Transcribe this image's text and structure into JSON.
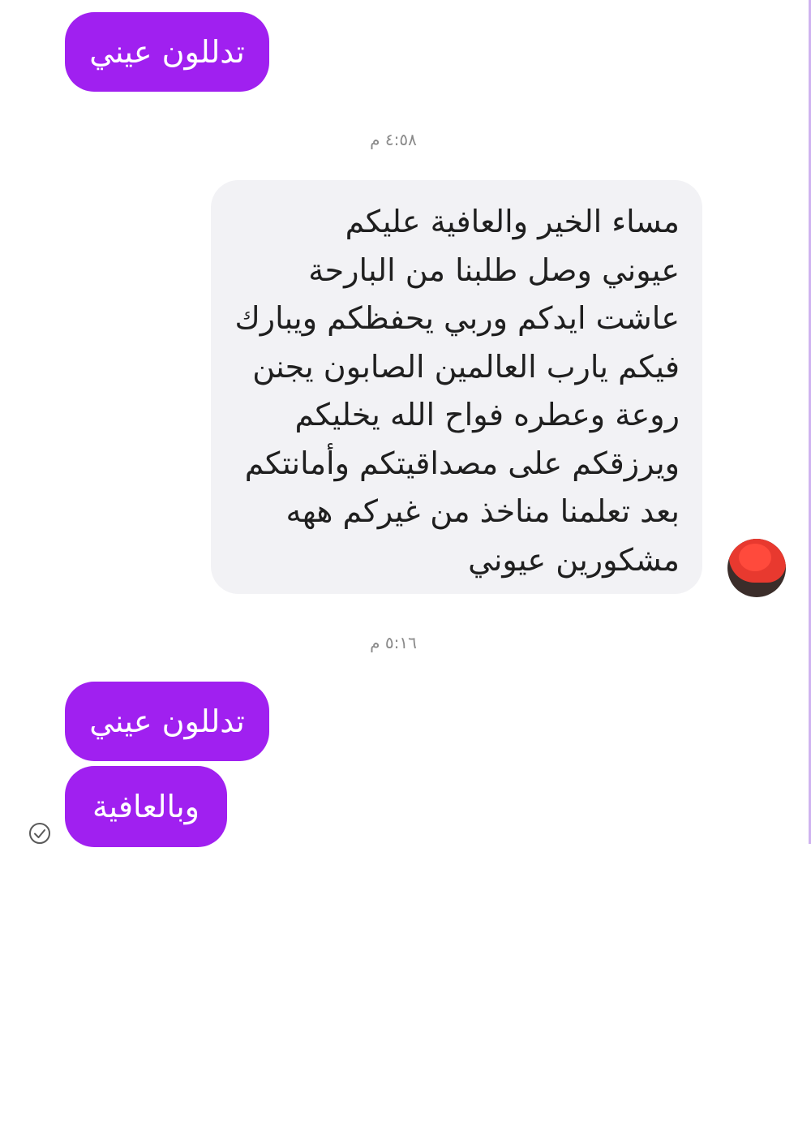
{
  "messages": {
    "sent_1": "تدللون عيني",
    "time_1": "٤:٥٨ م",
    "received_lines": [
      "مساء الخير والعافية عليكم",
      "عيوني وصل طلبنا من البارحة",
      "عاشت ايدكم وربي يحفظكم ويبارك",
      "فيكم يارب العالمين  الصابون يجنن",
      "روعة وعطره فواح الله يخليكم",
      "ويرزقكم على مصداقيتكم وأمانتكم",
      "بعد تعلمنا مناخذ من غيركم ههه",
      "مشكورين عيوني"
    ],
    "time_2": "٥:١٦ م",
    "sent_2": "تدللون عيني",
    "sent_3": "وبالعافية"
  },
  "colors": {
    "sent_bubble": "#a020f0",
    "received_bubble": "#f2f2f5",
    "timestamp_text": "#8a8a8a"
  },
  "icons": {
    "status": "seen-check-icon",
    "avatar": "avatar"
  }
}
